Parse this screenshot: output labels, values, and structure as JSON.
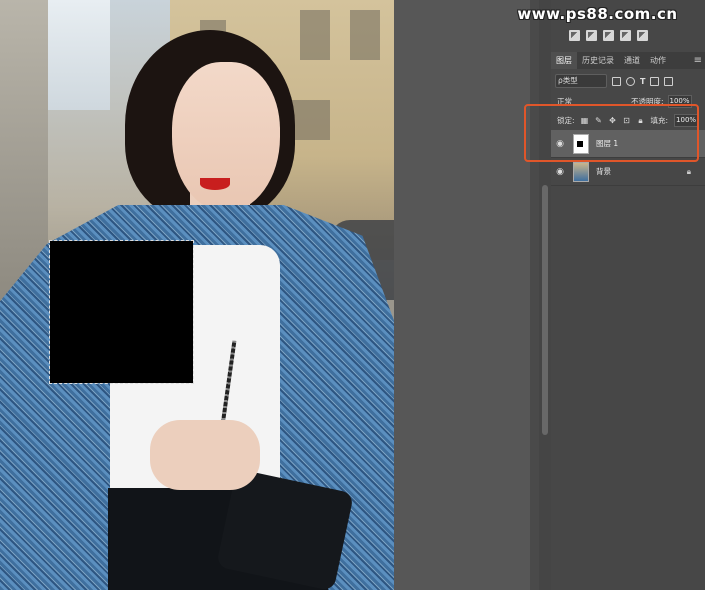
{
  "watermark": "www.ps88.com.cn",
  "layers_panel": {
    "tabs": [
      {
        "label": "图层",
        "active": true
      },
      {
        "label": "历史记录",
        "active": false
      },
      {
        "label": "通道",
        "active": false
      },
      {
        "label": "动作",
        "active": false
      }
    ],
    "menu_icon": "panel-menu-icon",
    "filter_select": "ρ类型",
    "filter_icons": [
      "pixel-filter-icon",
      "adjustment-filter-icon",
      "type-filter-icon",
      "shape-filter-icon",
      "smart-object-filter-icon"
    ],
    "blend_mode": "正常",
    "opacity_label": "不透明度:",
    "opacity_value": "100%",
    "lock_label": "锁定:",
    "lock_icons": [
      "lock-transparent-icon",
      "lock-paint-icon",
      "lock-move-icon",
      "lock-artboard-icon",
      "lock-all-icon"
    ],
    "fill_label": "填充:",
    "fill_value": "100%",
    "layers": [
      {
        "name": "图层 1",
        "selected": true,
        "visible": true,
        "locked": false
      },
      {
        "name": "背景",
        "selected": false,
        "visible": true,
        "locked": true
      }
    ]
  },
  "colors": {
    "highlight_border": "#e0562a",
    "panel_bg": "#474747",
    "selected_layer": "#616161"
  }
}
